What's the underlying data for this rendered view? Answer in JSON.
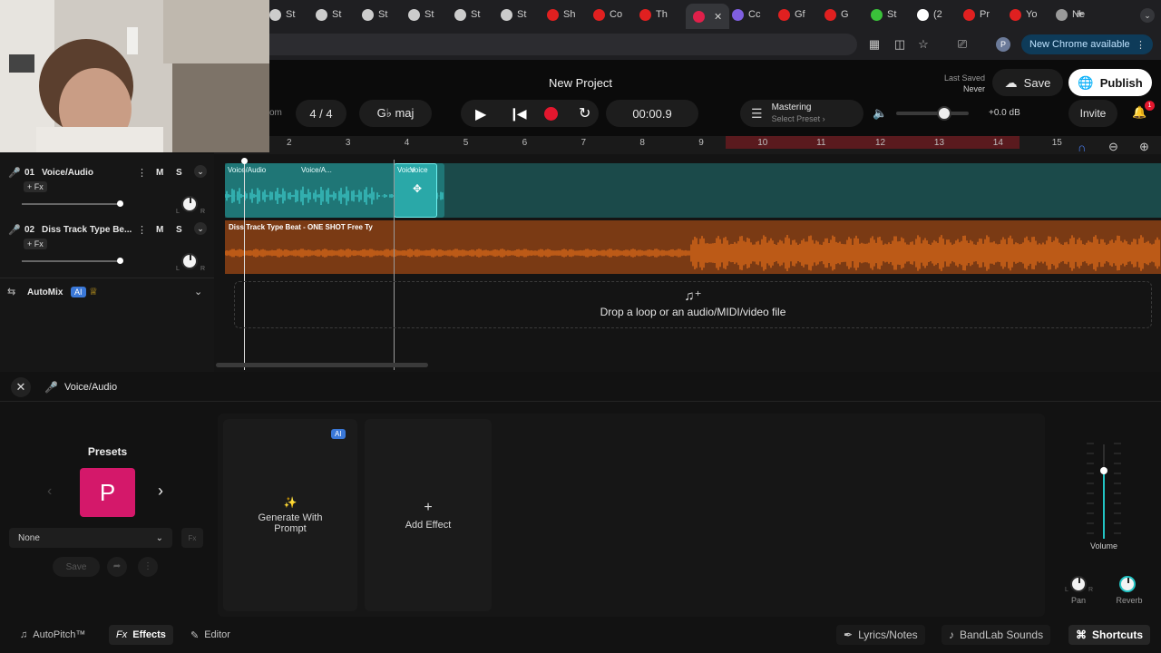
{
  "browser": {
    "tabs": [
      {
        "label": "St",
        "icon": "anchor-icon",
        "color": "#cccccc"
      },
      {
        "label": "St",
        "icon": "anchor-icon",
        "color": "#cccccc"
      },
      {
        "label": "St",
        "icon": "anchor-icon",
        "color": "#cccccc"
      },
      {
        "label": "St",
        "icon": "anchor-icon",
        "color": "#cccccc"
      },
      {
        "label": "St",
        "icon": "anchor-icon",
        "color": "#cccccc"
      },
      {
        "label": "St",
        "icon": "anchor-icon",
        "color": "#cccccc"
      },
      {
        "label": "Sh",
        "icon": "youtube-icon",
        "color": "#e02020"
      },
      {
        "label": "Co",
        "icon": "youtube-icon",
        "color": "#e02020"
      },
      {
        "label": "Th",
        "icon": "youtube-icon",
        "color": "#e02020"
      },
      {
        "label": "",
        "icon": "bandlab-icon",
        "color": "#e0204a"
      },
      {
        "label": "Cc",
        "icon": "colorwheel-icon",
        "color": "#7f5fe0"
      },
      {
        "label": "Gf",
        "icon": "bandlab-icon",
        "color": "#e02020"
      },
      {
        "label": "G",
        "icon": "bandlab-icon",
        "color": "#e02020"
      },
      {
        "label": "St",
        "icon": "k-icon",
        "color": "#3ac23a"
      },
      {
        "label": "(2",
        "icon": "x-icon",
        "color": "#ffffff"
      },
      {
        "label": "Pr",
        "icon": "youtube-icon",
        "color": "#e02020"
      },
      {
        "label": "Yo",
        "icon": "youtube-icon",
        "color": "#e02020"
      },
      {
        "label": "Ne",
        "icon": "chrome-icon",
        "color": "#9a9a9a"
      }
    ],
    "new_chrome_label": "New Chrome available",
    "profile_initial": "P"
  },
  "header": {
    "project_title": "New Project",
    "last_saved_label": "Last Saved",
    "last_saved_value": "Never",
    "save_label": "Save",
    "publish_label": "Publish",
    "bpm_fragment": "om",
    "time_signature": "4 / 4",
    "key": "G♭ maj",
    "time_display": "00:00.9",
    "mastering_title": "Mastering",
    "mastering_preset": "Select Preset",
    "volume_db": "+0.0 dB",
    "invite_label": "Invite",
    "notification_count": "1"
  },
  "ruler": {
    "marks": [
      "2",
      "3",
      "4",
      "5",
      "6",
      "7",
      "8",
      "9",
      "10",
      "11",
      "12",
      "13",
      "14",
      "15"
    ]
  },
  "tracks": [
    {
      "number": "01",
      "name": "Voice/Audio",
      "fx": "+ Fx",
      "mute": "M",
      "solo": "S",
      "pan_l": "L",
      "pan_r": "R",
      "color": "#22c4c4"
    },
    {
      "number": "02",
      "name": "Diss Track Type Be...",
      "fx": "+ Fx",
      "mute": "M",
      "solo": "S",
      "pan_l": "L",
      "pan_r": "R",
      "color": "#f07a20"
    }
  ],
  "automix": {
    "label": "AutoMix",
    "badge": "AI"
  },
  "clips": {
    "voice": [
      "Voice/Audio",
      "Voice/A...",
      "Voice",
      "Voice"
    ],
    "beat": "Diss Track Type Beat - ONE SHOT  Free Ty"
  },
  "drop_zone": "Drop a loop or an audio/MIDI/video file",
  "panel": {
    "track_title": "Voice/Audio",
    "presets_title": "Presets",
    "preset_letter": "P",
    "preset_select": "None",
    "save_label": "Save",
    "ai_badge": "AI",
    "generate_label": "Generate With Prompt",
    "add_effect_label": "Add Effect",
    "volume_label": "Volume",
    "volume_level": 0.72,
    "pan_label": "Pan",
    "reverb_label": "Reverb",
    "pan_l": "L",
    "pan_r": "R"
  },
  "footer": {
    "autopitch": "AutoPitch™",
    "effects": "Effects",
    "editor": "Editor",
    "lyrics": "Lyrics/Notes",
    "sounds": "BandLab Sounds",
    "shortcuts": "Shortcuts"
  }
}
